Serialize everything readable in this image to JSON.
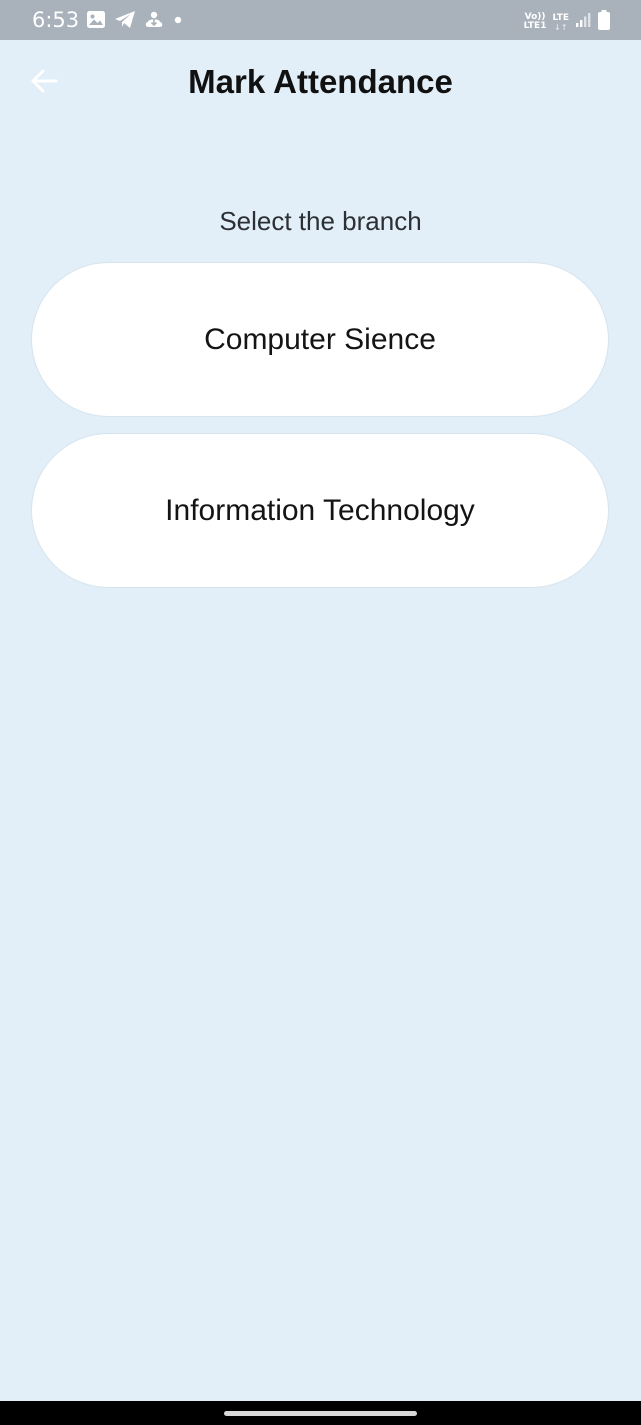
{
  "status_bar": {
    "time": "6:53",
    "network_volte_top": "Vo))",
    "network_volte_bottom": "LTE1",
    "network_lte": "LTE",
    "network_arrows": "↓↑",
    "icons": [
      "image-icon",
      "telegram-icon",
      "cloud-download-icon",
      "dot-icon",
      "signal-icon",
      "battery-icon"
    ]
  },
  "app_bar": {
    "title": "Mark Attendance",
    "back_icon": "arrow-left-icon"
  },
  "main": {
    "prompt": "Select the branch",
    "branches": [
      {
        "label": "Computer Sience"
      },
      {
        "label": "Information Technology"
      }
    ]
  },
  "colors": {
    "background": "#e2eff9",
    "status_bar": "#a9b1bb",
    "button_background": "#ffffff",
    "text": "#111111"
  }
}
